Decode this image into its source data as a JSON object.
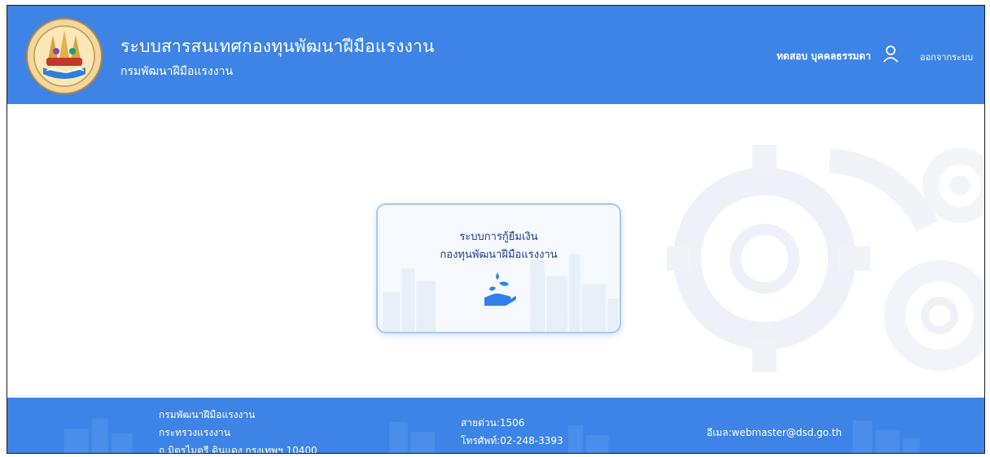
{
  "header": {
    "title": "ระบบสารสนเทศกองทุนพัฒนาฝีมือแรงงาน",
    "subtitle": "กรมพัฒนาฝีมือแรงงาน",
    "user_name": "ทดสอบ บุคคลธรรมดา",
    "user_icon": "user-icon",
    "logout_label": "ออกจากระบบ",
    "logo_icon": "department-seal-logo"
  },
  "main": {
    "card": {
      "line1": "ระบบการกู้ยืมเงิน",
      "line2": "กองทุนพัฒนาฝีมือแรงงาน",
      "icon": "hand-seedling-icon"
    }
  },
  "footer": {
    "org_line1": "กรมพัฒนาฝีมือแรงงาน",
    "org_line2": "กระทรวงแรงงาน",
    "org_line3": "ถ.มิตรไมตรี ดินแดง กรุงเทพฯ 10400",
    "hotline": "สายด่วน:1506",
    "phone": "โทรศัพท์:02-248-3393",
    "email": "อีเมล:webmaster@dsd.go.th"
  },
  "colors": {
    "primary": "#3d84e6",
    "card_border": "#a9c8f0",
    "card_text": "#1d3f8f",
    "icon_blue": "#2f80ed"
  }
}
